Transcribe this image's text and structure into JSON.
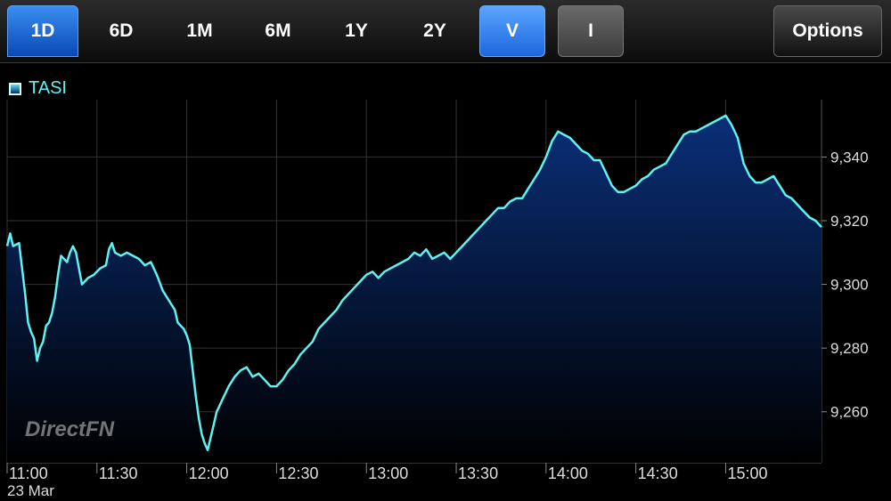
{
  "toolbar": {
    "tabs": [
      {
        "label": "1D",
        "active": true
      },
      {
        "label": "6D",
        "active": false
      },
      {
        "label": "1M",
        "active": false
      },
      {
        "label": "6M",
        "active": false
      },
      {
        "label": "1Y",
        "active": false
      },
      {
        "label": "2Y",
        "active": false
      }
    ],
    "toggles": [
      {
        "label": "V",
        "on": true
      },
      {
        "label": "I",
        "on": false
      }
    ],
    "options_label": "Options"
  },
  "watermark": "DirectFN",
  "date_label": "23 Mar",
  "colors": {
    "line": "#5ff2f2",
    "fill_top": "#0a2f78",
    "accent": "#1f6fe0"
  },
  "chart_data": {
    "type": "area",
    "legend": [
      "TASI"
    ],
    "xlabels": [
      "11:00",
      "11:30",
      "12:00",
      "12:30",
      "13:00",
      "13:30",
      "14:00",
      "14:30",
      "15:00"
    ],
    "xlim_minutes": [
      0,
      272
    ],
    "yticks": [
      9260,
      9280,
      9300,
      9320,
      9340
    ],
    "ylim": [
      9244,
      9358
    ],
    "grid": true,
    "series": [
      {
        "name": "TASI",
        "points": [
          [
            0,
            9312
          ],
          [
            1,
            9316
          ],
          [
            2,
            9312
          ],
          [
            4,
            9313
          ],
          [
            5,
            9305
          ],
          [
            6,
            9297
          ],
          [
            7,
            9288
          ],
          [
            8,
            9285
          ],
          [
            9,
            9283
          ],
          [
            10,
            9276
          ],
          [
            11,
            9280
          ],
          [
            12,
            9282
          ],
          [
            13,
            9287
          ],
          [
            14,
            9288
          ],
          [
            15,
            9291
          ],
          [
            16,
            9296
          ],
          [
            17,
            9303
          ],
          [
            18,
            9309
          ],
          [
            19,
            9308
          ],
          [
            20,
            9307
          ],
          [
            21,
            9310
          ],
          [
            22,
            9312
          ],
          [
            23,
            9310
          ],
          [
            25,
            9300
          ],
          [
            27,
            9302
          ],
          [
            29,
            9303
          ],
          [
            31,
            9305
          ],
          [
            33,
            9306
          ],
          [
            34,
            9311
          ],
          [
            35,
            9313
          ],
          [
            36,
            9310
          ],
          [
            38,
            9309
          ],
          [
            40,
            9310
          ],
          [
            42,
            9309
          ],
          [
            44,
            9308
          ],
          [
            46,
            9306
          ],
          [
            48,
            9307
          ],
          [
            50,
            9303
          ],
          [
            52,
            9298
          ],
          [
            54,
            9295
          ],
          [
            56,
            9292
          ],
          [
            57,
            9288
          ],
          [
            58,
            9287
          ],
          [
            59,
            9286
          ],
          [
            60,
            9284
          ],
          [
            61,
            9281
          ],
          [
            62,
            9273
          ],
          [
            63,
            9265
          ],
          [
            64,
            9258
          ],
          [
            65,
            9253
          ],
          [
            66,
            9250
          ],
          [
            67,
            9248
          ],
          [
            68,
            9252
          ],
          [
            69,
            9256
          ],
          [
            70,
            9260
          ],
          [
            71,
            9262
          ],
          [
            72,
            9264
          ],
          [
            74,
            9268
          ],
          [
            76,
            9271
          ],
          [
            78,
            9273
          ],
          [
            80,
            9274
          ],
          [
            82,
            9271
          ],
          [
            84,
            9272
          ],
          [
            86,
            9270
          ],
          [
            88,
            9268
          ],
          [
            90,
            9268
          ],
          [
            92,
            9270
          ],
          [
            94,
            9273
          ],
          [
            96,
            9275
          ],
          [
            98,
            9278
          ],
          [
            100,
            9280
          ],
          [
            102,
            9282
          ],
          [
            104,
            9286
          ],
          [
            106,
            9288
          ],
          [
            108,
            9290
          ],
          [
            110,
            9292
          ],
          [
            112,
            9295
          ],
          [
            114,
            9297
          ],
          [
            116,
            9299
          ],
          [
            118,
            9301
          ],
          [
            120,
            9303
          ],
          [
            122,
            9304
          ],
          [
            124,
            9302
          ],
          [
            126,
            9304
          ],
          [
            128,
            9305
          ],
          [
            130,
            9306
          ],
          [
            132,
            9307
          ],
          [
            134,
            9308
          ],
          [
            136,
            9310
          ],
          [
            138,
            9309
          ],
          [
            140,
            9311
          ],
          [
            142,
            9308
          ],
          [
            144,
            9309
          ],
          [
            146,
            9310
          ],
          [
            148,
            9308
          ],
          [
            150,
            9310
          ],
          [
            152,
            9312
          ],
          [
            154,
            9314
          ],
          [
            156,
            9316
          ],
          [
            158,
            9318
          ],
          [
            160,
            9320
          ],
          [
            162,
            9322
          ],
          [
            164,
            9324
          ],
          [
            166,
            9324
          ],
          [
            168,
            9326
          ],
          [
            170,
            9327
          ],
          [
            172,
            9327
          ],
          [
            174,
            9330
          ],
          [
            176,
            9333
          ],
          [
            178,
            9336
          ],
          [
            180,
            9340
          ],
          [
            182,
            9345
          ],
          [
            184,
            9348
          ],
          [
            186,
            9347
          ],
          [
            188,
            9346
          ],
          [
            190,
            9344
          ],
          [
            192,
            9342
          ],
          [
            194,
            9341
          ],
          [
            196,
            9339
          ],
          [
            198,
            9339
          ],
          [
            200,
            9335
          ],
          [
            202,
            9331
          ],
          [
            204,
            9329
          ],
          [
            206,
            9329
          ],
          [
            208,
            9330
          ],
          [
            210,
            9331
          ],
          [
            212,
            9333
          ],
          [
            214,
            9334
          ],
          [
            216,
            9336
          ],
          [
            218,
            9337
          ],
          [
            220,
            9338
          ],
          [
            222,
            9341
          ],
          [
            224,
            9344
          ],
          [
            226,
            9347
          ],
          [
            228,
            9348
          ],
          [
            230,
            9348
          ],
          [
            232,
            9349
          ],
          [
            234,
            9350
          ],
          [
            236,
            9351
          ],
          [
            238,
            9352
          ],
          [
            240,
            9353
          ],
          [
            242,
            9350
          ],
          [
            244,
            9346
          ],
          [
            246,
            9338
          ],
          [
            248,
            9334
          ],
          [
            250,
            9332
          ],
          [
            252,
            9332
          ],
          [
            254,
            9333
          ],
          [
            256,
            9334
          ],
          [
            258,
            9331
          ],
          [
            260,
            9328
          ],
          [
            262,
            9327
          ],
          [
            264,
            9325
          ],
          [
            266,
            9323
          ],
          [
            268,
            9321
          ],
          [
            270,
            9320
          ],
          [
            272,
            9318
          ]
        ]
      }
    ]
  }
}
